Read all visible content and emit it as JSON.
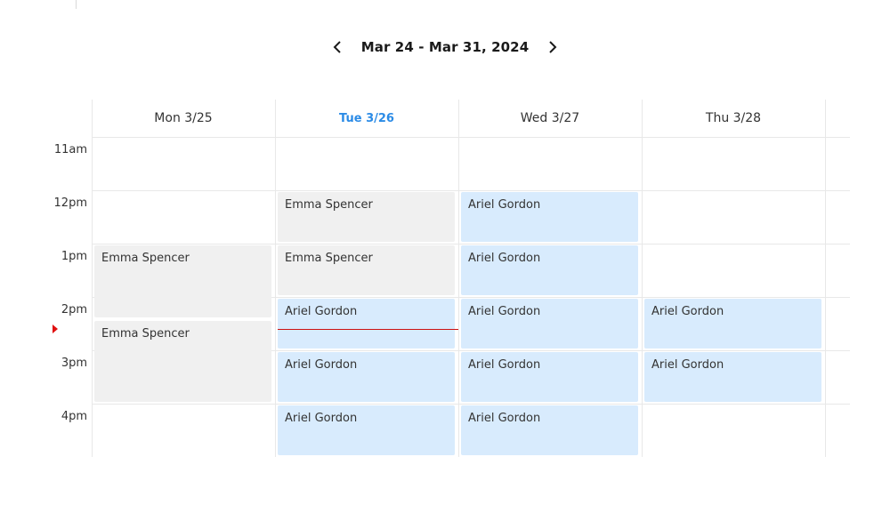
{
  "nav": {
    "title": "Mar 24 - Mar 31, 2024",
    "prev_icon": "chevron-left-icon",
    "next_icon": "chevron-right-icon"
  },
  "days": [
    {
      "label": "Mon 3/25",
      "today": false
    },
    {
      "label": "Tue 3/26",
      "today": true
    },
    {
      "label": "Wed 3/27",
      "today": false
    },
    {
      "label": "Thu 3/28",
      "today": false
    }
  ],
  "hours": [
    "11am",
    "12pm",
    "1pm",
    "2pm",
    "3pm",
    "4pm"
  ],
  "events": [
    {
      "day": 0,
      "start": "1pm",
      "end": "2:25pm",
      "title": "Emma Spencer",
      "color": "gray"
    },
    {
      "day": 0,
      "start": "2:25pm",
      "end": "4pm",
      "title": "Emma Spencer",
      "color": "gray"
    },
    {
      "day": 1,
      "start": "12pm",
      "end": "1pm",
      "title": "Emma Spencer",
      "color": "gray"
    },
    {
      "day": 1,
      "start": "1pm",
      "end": "2pm",
      "title": "Emma Spencer",
      "color": "gray"
    },
    {
      "day": 1,
      "start": "2pm",
      "end": "3pm",
      "title": "Ariel Gordon",
      "color": "blue"
    },
    {
      "day": 1,
      "start": "3pm",
      "end": "4pm",
      "title": "Ariel Gordon",
      "color": "blue"
    },
    {
      "day": 1,
      "start": "4pm",
      "end": "5pm",
      "title": "Ariel Gordon",
      "color": "blue"
    },
    {
      "day": 2,
      "start": "12pm",
      "end": "1pm",
      "title": "Ariel Gordon",
      "color": "blue"
    },
    {
      "day": 2,
      "start": "1pm",
      "end": "2pm",
      "title": "Ariel Gordon",
      "color": "blue"
    },
    {
      "day": 2,
      "start": "2pm",
      "end": "3pm",
      "title": "Ariel Gordon",
      "color": "blue"
    },
    {
      "day": 2,
      "start": "3pm",
      "end": "4pm",
      "title": "Ariel Gordon",
      "color": "blue"
    },
    {
      "day": 2,
      "start": "4pm",
      "end": "5pm",
      "title": "Ariel Gordon",
      "color": "blue"
    },
    {
      "day": 3,
      "start": "2pm",
      "end": "3pm",
      "title": "Ariel Gordon",
      "color": "blue"
    },
    {
      "day": 3,
      "start": "3pm",
      "end": "4pm",
      "title": "Ariel Gordon",
      "color": "blue"
    }
  ],
  "now_indicator": {
    "day": 1,
    "time": "2:36pm"
  },
  "colors": {
    "today": "#2b8be6",
    "event_gray": "#f0f0f0",
    "event_blue": "#d8ebfd",
    "now_line": "#cc1111"
  }
}
